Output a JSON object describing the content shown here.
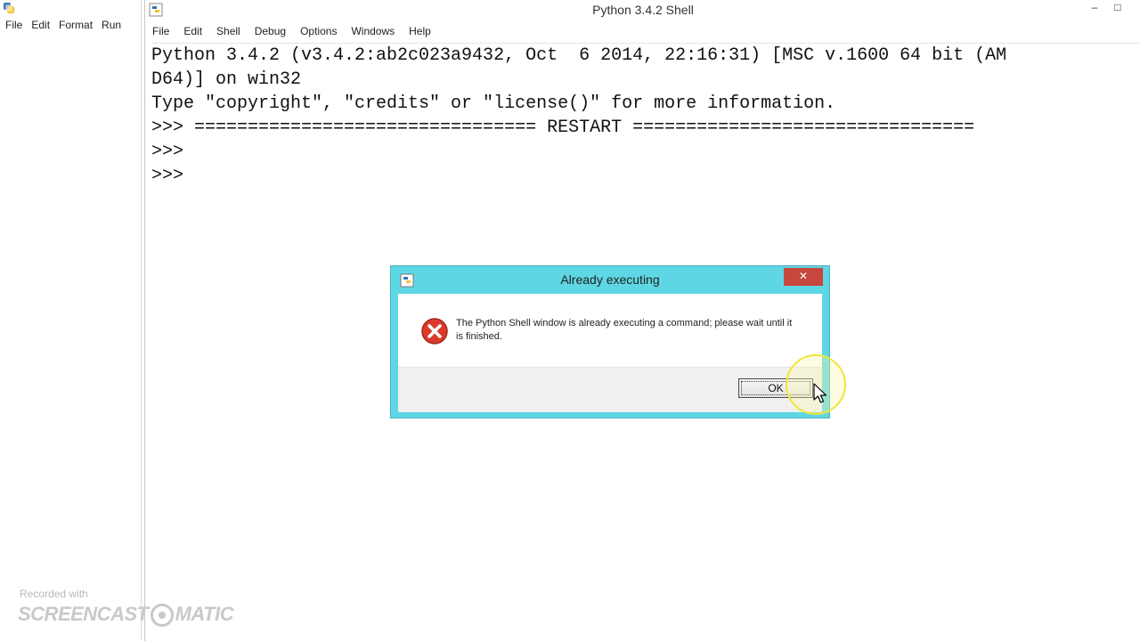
{
  "left_window": {
    "menu": [
      "File",
      "Edit",
      "Format",
      "Run"
    ]
  },
  "shell_window": {
    "title": "Python 3.4.2 Shell",
    "menu": [
      "File",
      "Edit",
      "Shell",
      "Debug",
      "Options",
      "Windows",
      "Help"
    ],
    "controls": {
      "minimize": "–",
      "maximize": "□"
    },
    "lines": [
      "Python 3.4.2 (v3.4.2:ab2c023a9432, Oct  6 2014, 22:16:31) [MSC v.1600 64 bit (AM",
      "D64)] on win32",
      "Type \"copyright\", \"credits\" or \"license()\" for more information.",
      ">>> ================================ RESTART ================================",
      ">>> ",
      ">>> "
    ]
  },
  "dialog": {
    "title": "Already executing",
    "close_label": "✕",
    "message": "The Python Shell window is already executing a command; please wait until it is finished.",
    "ok_label": "OK",
    "accent_color": "#5fd6e3"
  },
  "watermark": {
    "recorded_with": "Recorded with",
    "brand_left": "SCREENCAST",
    "brand_right": "MATIC"
  },
  "icons": {
    "app": "python-idle-icon",
    "error": "error-x-icon",
    "cursor": "mouse-pointer-icon"
  }
}
